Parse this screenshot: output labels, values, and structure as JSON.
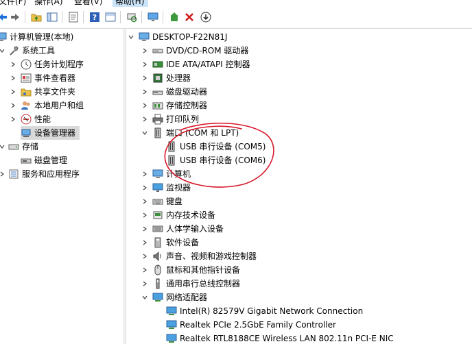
{
  "menu": {
    "file": "文件(F)",
    "action": "操作(A)",
    "view": "查看(V)",
    "help": "帮助(H)"
  },
  "left_tree": {
    "root": "计算机管理(本地)",
    "system_tools": "系统工具",
    "task_scheduler": "任务计划程序",
    "event_viewer": "事件查看器",
    "shared_folders": "共享文件夹",
    "local_users": "本地用户和组",
    "performance": "性能",
    "device_manager": "设备管理器",
    "storage": "存储",
    "disk_management": "磁盘管理",
    "services": "服务和应用程序"
  },
  "device_tree": {
    "computer_name": "DESKTOP-F22N81J",
    "categories": {
      "dvd": "DVD/CD-ROM 驱动器",
      "ide": "IDE ATA/ATAPI 控制器",
      "processor": "处理器",
      "disk": "磁盘驱动器",
      "storage": "存储控制器",
      "print_queue": "打印队列",
      "ports": "端口 (COM 和 LPT)",
      "computer": "计算机",
      "monitor": "监视器",
      "keyboard": "键盘",
      "memory_tech": "内存技术设备",
      "hid": "人体学输入设备",
      "software": "软件设备",
      "audio": "声音、视频和游戏控制器",
      "mouse": "鼠标和其他指针设备",
      "usb": "通用串行总线控制器",
      "network": "网络适配器"
    },
    "ports_children": [
      "USB 串行设备 (COM5)",
      "USB 串行设备 (COM6)"
    ],
    "network_children": [
      "Intel(R) 82579V Gigabit Network Connection",
      "Realtek PCIe 2.5GbE Family Controller",
      "Realtek RTL8188CE Wireless LAN 802.11n PCI-E NIC"
    ]
  },
  "colors": {
    "annotation": "#d7182a",
    "selection": "#d9d9d9",
    "menu_highlight": "#cce4f7"
  }
}
